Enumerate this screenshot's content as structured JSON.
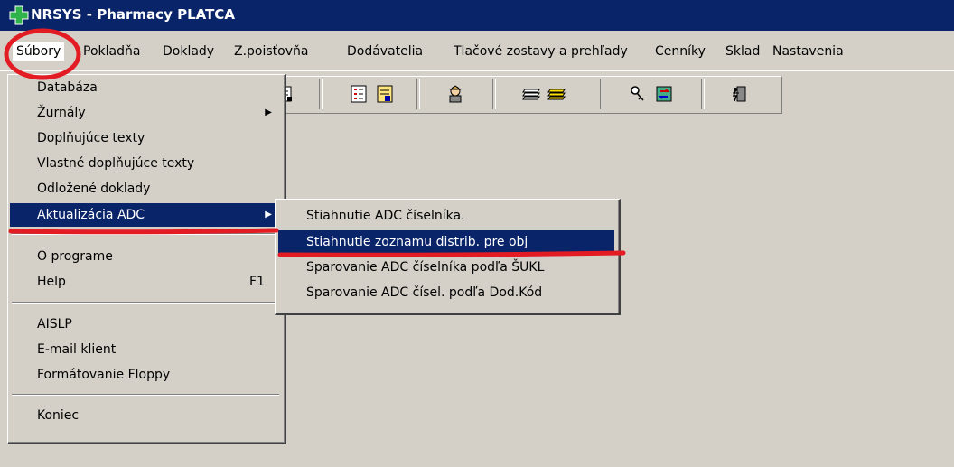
{
  "window": {
    "title": "NRSYS - Pharmacy  PLATCA",
    "icon": "pharmacy-cross-icon",
    "titlebar_color": "#0a246a"
  },
  "menubar": {
    "items": [
      {
        "label": "Súbory",
        "active": true
      },
      {
        "label": "Pokladňa"
      },
      {
        "label": "Doklady"
      },
      {
        "label": "Z.poisťovňa"
      },
      {
        "label": "Dodávatelia"
      },
      {
        "label": "Tlačové zostavy a prehľady"
      },
      {
        "label": "Cenníky"
      },
      {
        "label": "Sklad"
      },
      {
        "label": "Nastavenia"
      }
    ]
  },
  "toolbar": {
    "icons": [
      "report-icon",
      "checklist-icon",
      "document-edit-icon",
      "user-icon",
      "stack-icon",
      "stack-yellow-icon",
      "key-icon",
      "refresh-icon",
      "exit-icon"
    ]
  },
  "file_menu": {
    "items": [
      {
        "label": "Databáza"
      },
      {
        "label": "Žurnály",
        "submenu": true
      },
      {
        "label": "Doplňujúce texty"
      },
      {
        "label": "Vlastné doplňujúce texty"
      },
      {
        "label": "Odložené doklady"
      },
      {
        "label": "Aktualizácia ADC",
        "submenu": true,
        "highlighted": true
      },
      {
        "label": "O programe"
      },
      {
        "label": "Help",
        "shortcut": "F1"
      },
      {
        "label": "AISLP"
      },
      {
        "label": "E-mail klient"
      },
      {
        "label": "Formátovanie Floppy"
      },
      {
        "label": "Koniec"
      }
    ]
  },
  "adc_submenu": {
    "items": [
      {
        "label": "Stiahnutie ADC číselníka."
      },
      {
        "label": "Stiahnutie zoznamu distrib. pre obj",
        "highlighted": true
      },
      {
        "label": "Sparovanie ADC číselníka podľa ŠUKL"
      },
      {
        "label": "Sparovanie ADC čísel. podľa Dod.Kód"
      }
    ]
  },
  "colors": {
    "highlight": "#0a246a",
    "face": "#d4d0c8",
    "annotation": "#e31b23"
  }
}
